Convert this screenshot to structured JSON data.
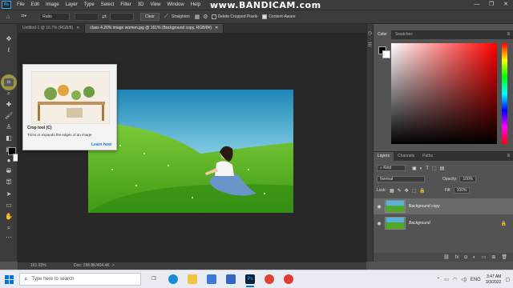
{
  "watermark": "www.BANDICAM.com",
  "menubar": {
    "logo": "Ps",
    "items": [
      "File",
      "Edit",
      "Image",
      "Layer",
      "Type",
      "Select",
      "Filter",
      "3D",
      "View",
      "Window",
      "Help"
    ],
    "window_controls": [
      "—",
      "❐",
      "✕"
    ]
  },
  "options": {
    "ratio": "Ratio",
    "clear": "Clear",
    "straighten": "Straighten",
    "delete_cropped": "Delete Cropped Pixels",
    "content_aware": "Content-Aware"
  },
  "tabs": [
    {
      "label": "Untitled-1 @ 16.7% (RGB/8)",
      "active": false
    },
    {
      "label": "class 4.20% image women.jpg @ 161% (Background copy, RGB/8#)",
      "active": true
    }
  ],
  "tooltip": {
    "title": "Crop tool (C)",
    "description": "Trims or expands the edges of an image",
    "link": "Learn how"
  },
  "statusbar": {
    "zoom": "161.93%",
    "doc": "Doc: 288.8K/404.4K",
    "arrow": ">"
  },
  "color_panel": {
    "tabs": [
      "Color",
      "Swatches"
    ],
    "foreground": "#000000",
    "background": "#ffffff",
    "hue": "#ff0000"
  },
  "layers_panel": {
    "tabs": [
      "Layers",
      "Channels",
      "Paths"
    ],
    "filter": "Kind",
    "blend_mode": "Normal",
    "opacity_label": "Opacity:",
    "opacity_value": "100%",
    "lock_label": "Lock:",
    "fill_label": "Fill:",
    "fill_value": "100%",
    "layers": [
      {
        "name": "Background copy",
        "selected": true,
        "italic": false
      },
      {
        "name": "Background",
        "selected": false,
        "italic": true
      }
    ]
  },
  "taskbar": {
    "search_placeholder": "Type here to search",
    "tray_lang": "ENG",
    "time": "3:47 AM",
    "date": "3/3/2022"
  }
}
